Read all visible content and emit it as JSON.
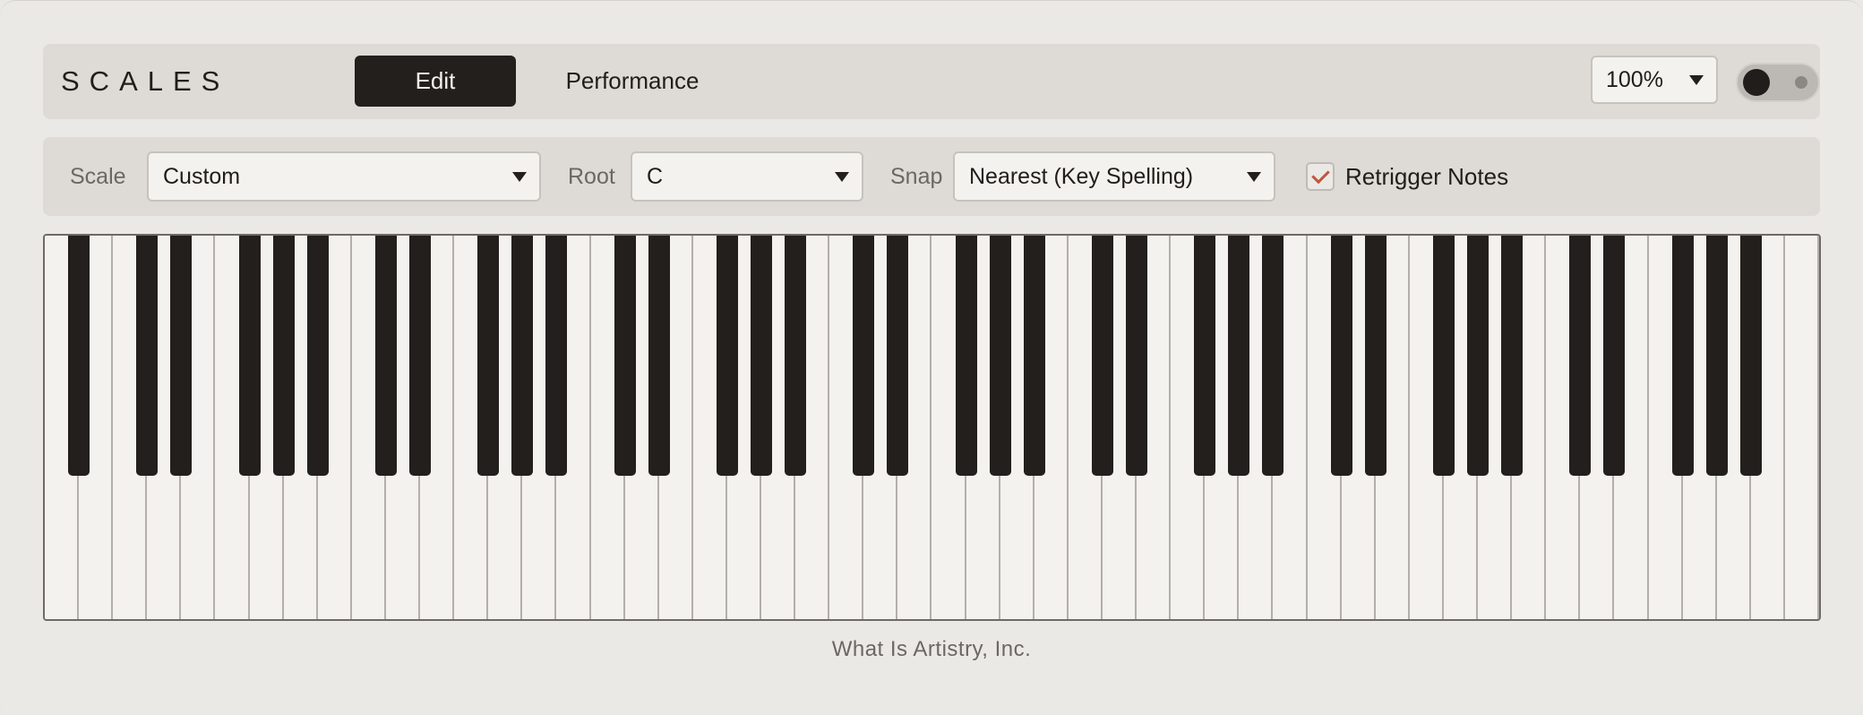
{
  "header": {
    "title": "SCALES",
    "tabs": [
      {
        "label": "Edit",
        "active": true
      },
      {
        "label": "Performance",
        "active": false
      }
    ],
    "zoom": "100%",
    "toggle_on": false
  },
  "controls": {
    "scale_label": "Scale",
    "scale_value": "Custom",
    "root_label": "Root",
    "root_value": "C",
    "snap_label": "Snap",
    "snap_value": "Nearest (Key Spelling)",
    "retrigger_label": "Retrigger Notes",
    "retrigger_checked": true
  },
  "keyboard": {
    "white_key_count": 52,
    "black_keys_present": true
  },
  "footer": "What Is Artistry, Inc.",
  "colors": {
    "accent": "#c0553e",
    "dark": "#231f1c",
    "panel": "#dedad6",
    "background": "#ebe9e5"
  }
}
